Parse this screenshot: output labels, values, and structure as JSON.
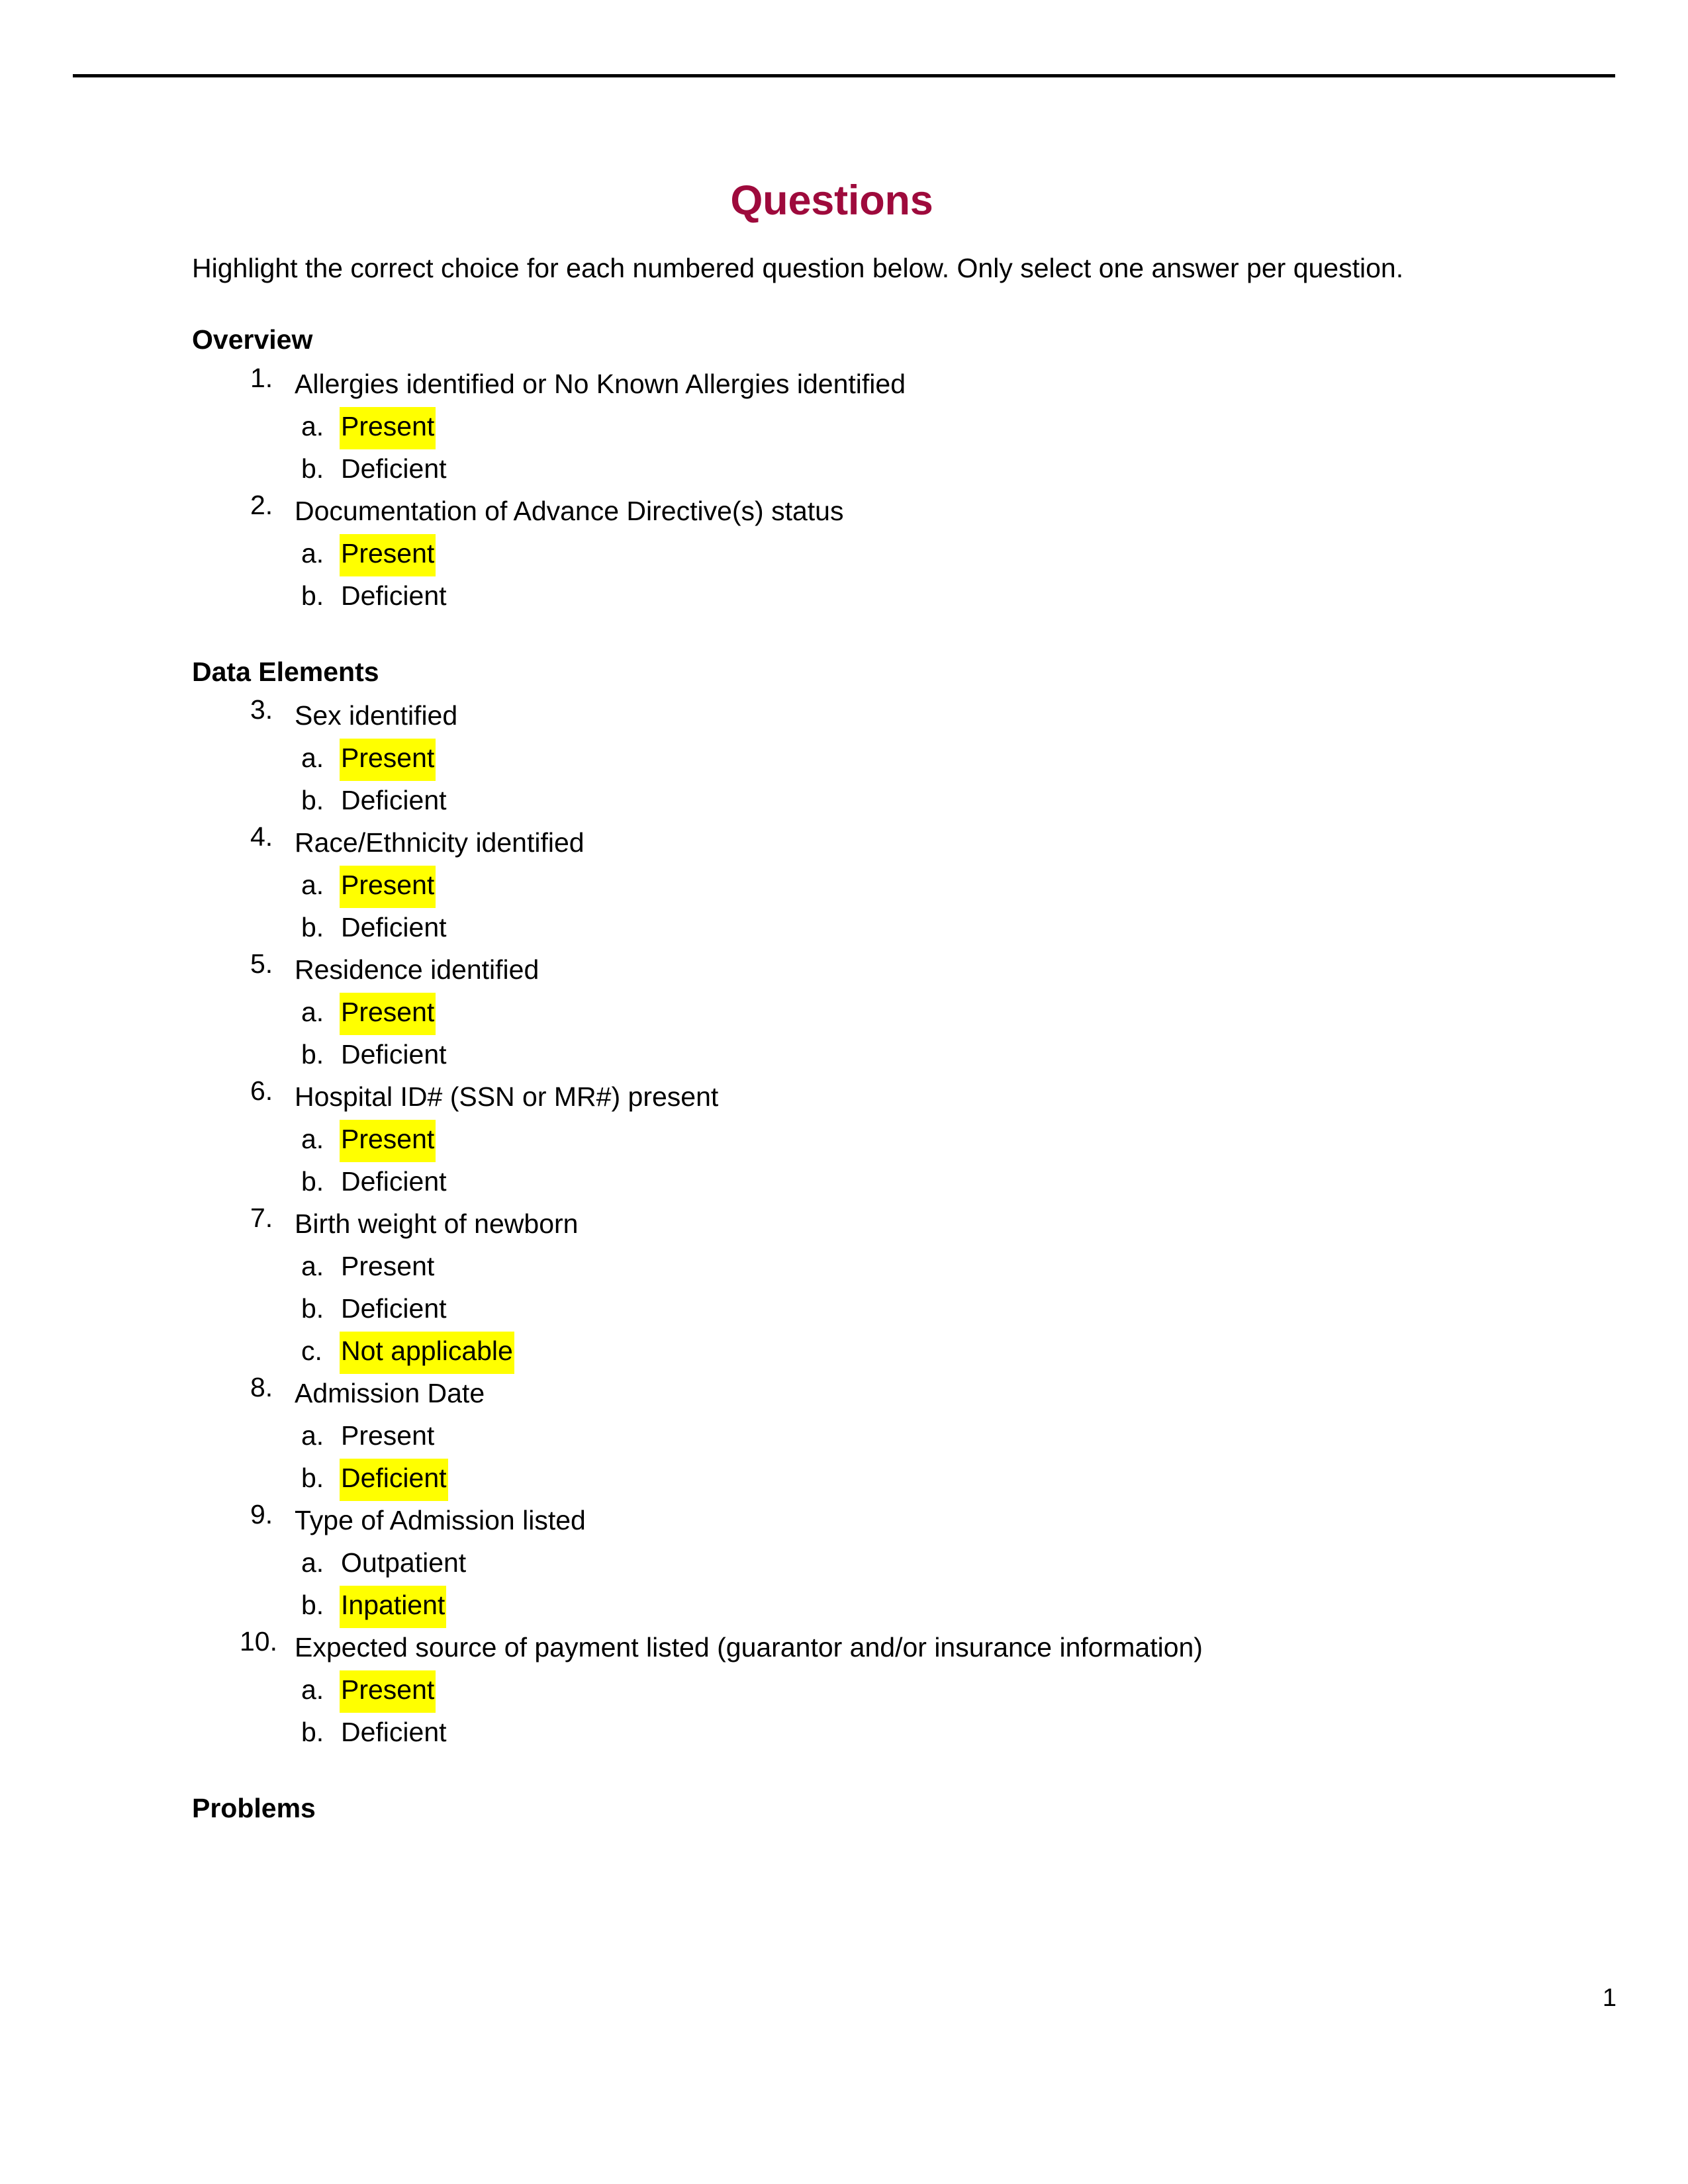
{
  "document": {
    "title": "Questions",
    "title_color": "#9E0A3C",
    "highlight_color": "#FFFF00",
    "intro": "Highlight the correct choice for each numbered question below. Only select one answer per question.",
    "page_number": "1"
  },
  "sections": [
    {
      "heading": "Overview",
      "questions": [
        {
          "number": "1.",
          "text": "Allergies identified or No Known Allergies identified",
          "options": [
            {
              "letter": "a.",
              "text": "Present",
              "highlighted": true
            },
            {
              "letter": "b.",
              "text": "Deficient",
              "highlighted": false
            }
          ]
        },
        {
          "number": "2.",
          "text": "Documentation of Advance Directive(s) status",
          "options": [
            {
              "letter": "a.",
              "text": "Present",
              "highlighted": true
            },
            {
              "letter": "b.",
              "text": "Deficient",
              "highlighted": false
            }
          ]
        }
      ]
    },
    {
      "heading": "Data Elements",
      "questions": [
        {
          "number": "3.",
          "text": "Sex identified",
          "options": [
            {
              "letter": "a.",
              "text": "Present",
              "highlighted": true
            },
            {
              "letter": "b.",
              "text": "Deficient",
              "highlighted": false
            }
          ]
        },
        {
          "number": "4.",
          "text": "Race/Ethnicity identified",
          "options": [
            {
              "letter": "a.",
              "text": "Present",
              "highlighted": true
            },
            {
              "letter": "b.",
              "text": "Deficient",
              "highlighted": false
            }
          ]
        },
        {
          "number": "5.",
          "text": "Residence identified",
          "options": [
            {
              "letter": "a.",
              "text": "Present",
              "highlighted": true
            },
            {
              "letter": "b.",
              "text": "Deficient",
              "highlighted": false
            }
          ]
        },
        {
          "number": "6.",
          "text": "Hospital ID# (SSN or MR#) present",
          "options": [
            {
              "letter": "a.",
              "text": "Present",
              "highlighted": true
            },
            {
              "letter": "b.",
              "text": "Deficient",
              "highlighted": false
            }
          ]
        },
        {
          "number": "7.",
          "text": "Birth weight of newborn",
          "options": [
            {
              "letter": "a.",
              "text": "Present",
              "highlighted": false
            },
            {
              "letter": "b.",
              "text": "Deficient",
              "highlighted": false
            },
            {
              "letter": "c.",
              "text": "Not applicable",
              "highlighted": true
            }
          ]
        },
        {
          "number": "8.",
          "text": "Admission Date",
          "options": [
            {
              "letter": "a.",
              "text": "Present",
              "highlighted": false
            },
            {
              "letter": "b.",
              "text": "Deficient",
              "highlighted": true
            }
          ]
        },
        {
          "number": "9.",
          "text": "Type of Admission listed",
          "options": [
            {
              "letter": "a.",
              "text": "Outpatient",
              "highlighted": false
            },
            {
              "letter": "b.",
              "text": "Inpatient",
              "highlighted": true
            }
          ]
        },
        {
          "number": "10.",
          "text": "Expected source of payment listed (guarantor and/or insurance information)",
          "options": [
            {
              "letter": "a.",
              "text": "Present",
              "highlighted": true
            },
            {
              "letter": "b.",
              "text": "Deficient",
              "highlighted": false
            }
          ]
        }
      ]
    },
    {
      "heading": "Problems",
      "questions": []
    }
  ]
}
